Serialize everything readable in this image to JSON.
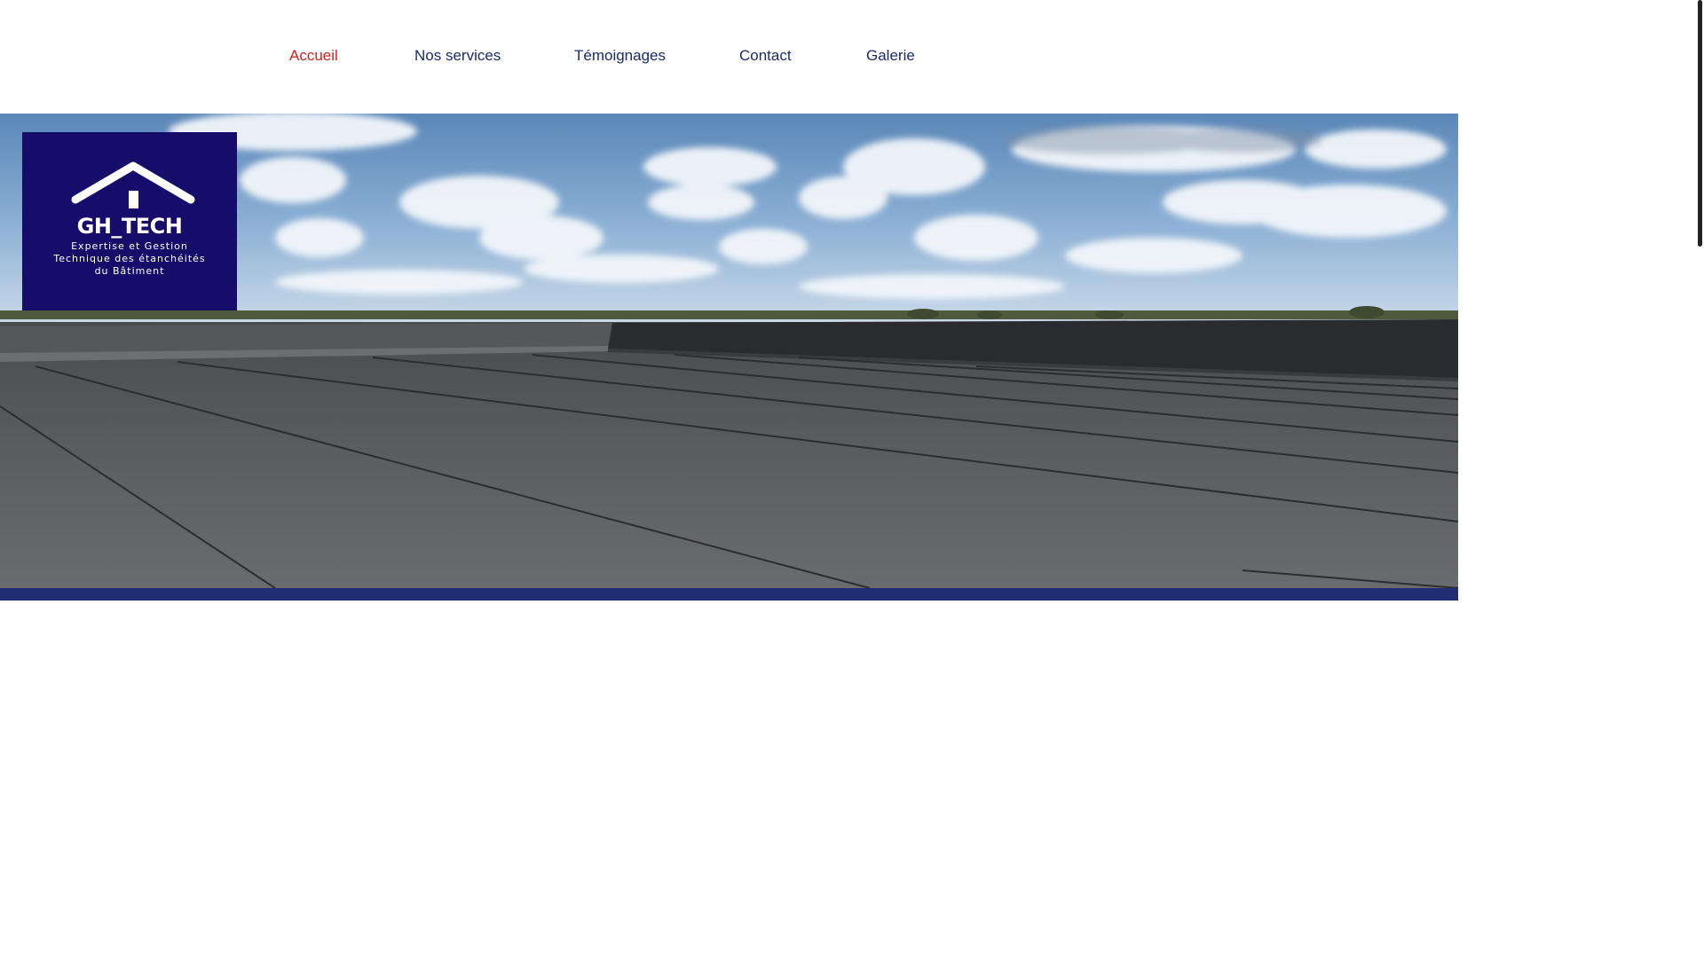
{
  "nav": {
    "items": [
      {
        "label": "Accueil",
        "active": true
      },
      {
        "label": "Nos services",
        "active": false
      },
      {
        "label": "Témoignages",
        "active": false
      },
      {
        "label": "Contact",
        "active": false
      },
      {
        "label": "Galerie",
        "active": false
      }
    ]
  },
  "logo": {
    "name": "GH_TECH",
    "tagline_1": "Expertise et Gestion",
    "tagline_2": "Technique des étanchéités",
    "tagline_3": "du Bâtiment",
    "background_color": "#160d6b",
    "icon": "house-roof-icon"
  },
  "hero": {
    "image": "flat-roof-bitumen-membrane-under-cloudy-sky",
    "bar_color": "#1f2f72"
  },
  "colors": {
    "nav_text": "#1c2a6b",
    "nav_active": "#d81e1e"
  }
}
